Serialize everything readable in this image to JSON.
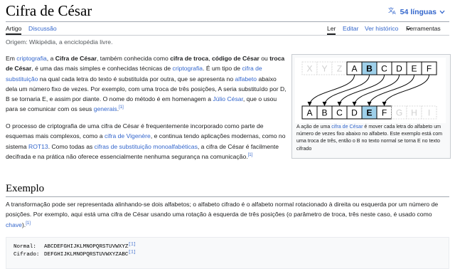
{
  "title": "Cifra de César",
  "languages": {
    "count_label": "54 línguas"
  },
  "tabs_left": [
    {
      "label": "Artigo"
    },
    {
      "label": "Discussão"
    }
  ],
  "tabs_right": [
    {
      "label": "Ler"
    },
    {
      "label": "Editar"
    },
    {
      "label": "Ver histórico"
    },
    {
      "label": "Ferramentas"
    }
  ],
  "origin": "Origem: Wikipédia, a enciclopédia livre.",
  "figure": {
    "top_row": [
      "X",
      "Y",
      "Z",
      "A",
      "B",
      "C",
      "D",
      "E",
      "F"
    ],
    "bottom_row": [
      "A",
      "B",
      "C",
      "D",
      "E",
      "F",
      "G",
      "H",
      "I"
    ],
    "highlight_top": "B",
    "highlight_bottom": "E",
    "caption": {
      "t1": "A ação de uma ",
      "l1": "cifra de César",
      "t2": " é mover cada letra do alfabeto um número de vezes fixo abaixo no alfabeto. Este exemplo está com uma troca de três, então o B no texto normal se torna E no texto cifrado"
    }
  },
  "para1": {
    "t1": "Em ",
    "l1": "criptografia",
    "t2": ", a ",
    "b1": "Cifra de César",
    "t3": ", também conhecida como ",
    "b2": "cifra de troca",
    "t4": ", ",
    "b3": "código de César",
    "t5": " ou ",
    "b4": "troca de César",
    "t6": ", é uma das mais simples e conhecidas técnicas de ",
    "l2": "criptografia",
    "t7": ". É um tipo de ",
    "l3": "cifra de substituição",
    "t8": " na qual cada letra do texto é substituída por outra, que se apresenta no ",
    "l4": "alfabeto",
    "t9": " abaixo dela um número fixo de vezes. Por exemplo, com uma troca de três posições, A seria substituído por D, B se tornaria E, e assim por diante. O nome do método é em homenagem a ",
    "l5": "Júlio César",
    "t10": ", que o usou para se comunicar com os seus ",
    "l6": "generais",
    "t11": ".",
    "r1": "[1]"
  },
  "para2": {
    "t1": "O processo de criptografia de uma cifra de César é frequentemente incorporado como parte de esquemas mais complexos, como a ",
    "l1": "cifra de Vigenère",
    "t2": ", e continua tendo aplicações modernas, como no sistema ",
    "l2": "ROT13",
    "t3": ". Como todas as ",
    "l3": "cifras de substituição monoalfabéticas",
    "t4": ", a cifra de César é facilmente decifrada e na prática não oferece essencialmente nenhuma segurança na comunicação.",
    "r1": "[1]"
  },
  "section": {
    "heading": "Exemplo",
    "t1": "A transformação pode ser representada alinhando-se dois alfabetos; o alfabeto cifrado é o alfabeto normal rotacionado à direita ou esquerda por um número de posições. Por exemplo, aqui está uma cifra de César usando uma rotação à esquerda de três posições (o parâmetro de troca, três neste caso, é usado como ",
    "l1": "chave",
    "t2": ").",
    "r1": "[1]"
  },
  "pre": {
    "normal_label": "Normal:",
    "normal_value": "ABCDEFGHIJKLMNOPQRSTUVWXYZ",
    "normal_ref": "[1]",
    "cipher_label": "Cifrado:",
    "cipher_value": "DEFGHIJKLMNOPQRSTUVWXYZABC",
    "cipher_ref": "[1]"
  },
  "colors": {
    "link": "#3366cc",
    "highlight": "#9ed0ea"
  },
  "icons": [
    "translate-icon",
    "chevron-down-icon"
  ]
}
